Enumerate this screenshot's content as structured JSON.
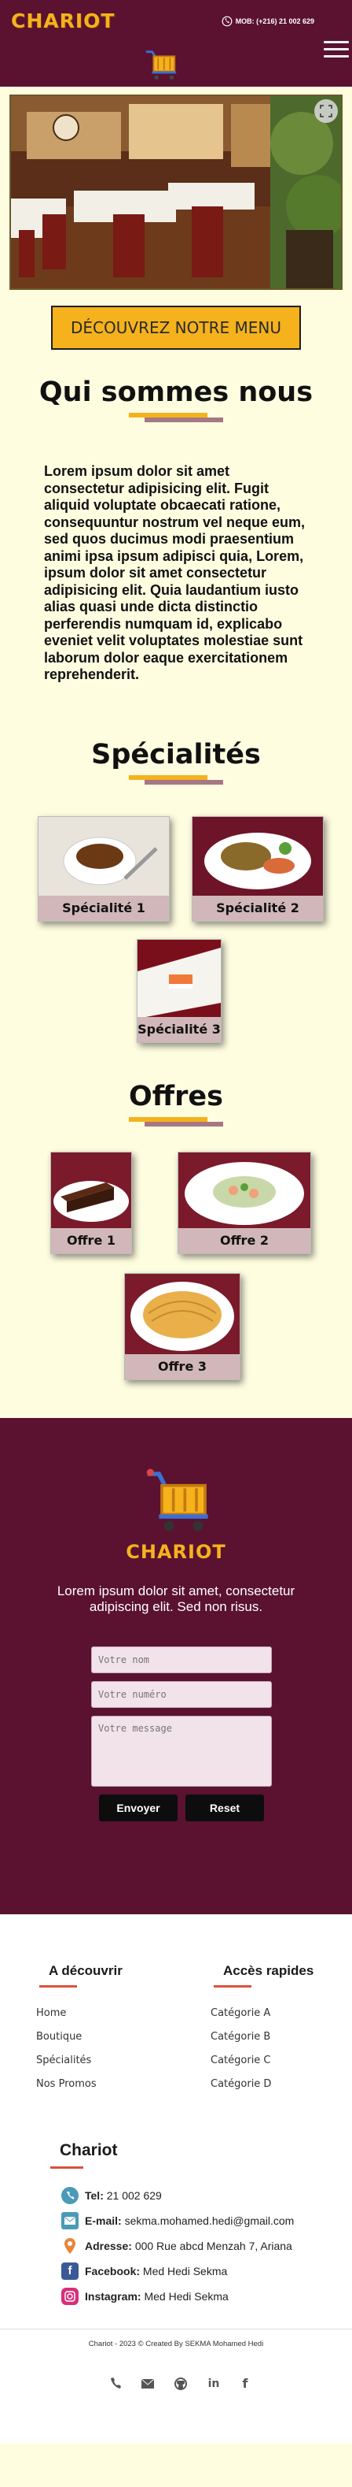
{
  "header": {
    "brand": "CHARIOT",
    "phone": "MOB: (+216) 21 002 629"
  },
  "hero": {
    "cta": "DÉCOUVREZ NOTRE MENU"
  },
  "about": {
    "title": "Qui sommes nous",
    "text": "Lorem ipsum dolor sit amet consectetur adipisicing elit. Fugit aliquid voluptate obcaecati ratione, consequuntur nostrum vel neque eum, sed quos ducimus modi praesentium animi ipsa ipsum adipisci quia, Lorem, ipsum dolor sit amet consectetur adipisicing elit. Quia laudantium iusto alias quasi unde dicta distinctio perferendis numquam id, explicabo eveniet velit voluptates molestiae sunt laborum dolor eaque exercitationem reprehenderit."
  },
  "specialites": {
    "title": "Spécialités",
    "items": [
      "Spécialité 1",
      "Spécialité 2",
      "Spécialité 3"
    ]
  },
  "offres": {
    "title": "Offres",
    "items": [
      "Offre 1",
      "Offre 2",
      "Offre 3"
    ]
  },
  "contact": {
    "brand": "CHARIOT",
    "text": "Lorem ipsum dolor sit amet, consectetur adipiscing elit. Sed non risus.",
    "name_placeholder": "Votre nom",
    "number_placeholder": "Votre numéro",
    "message_placeholder": "Votre message",
    "send": "Envoyer",
    "reset": "Reset"
  },
  "footer": {
    "col1_title": "A découvrir",
    "col1_links": [
      "Home",
      "Boutique",
      "Spécialités",
      "Nos Promos"
    ],
    "col2_title": "Accès rapides",
    "col2_links": [
      "Catégorie A",
      "Catégorie B",
      "Catégorie C",
      "Catégorie D"
    ],
    "contact_title": "Chariot",
    "tel_label": "Tel:",
    "tel_value": "21 002 629",
    "email_label": "E-mail:",
    "email_value": "sekma.mohamed.hedi@gmail.com",
    "address_label": "Adresse:",
    "address_value": "000 Rue abcd Menzah 7, Ariana",
    "facebook_label": "Facebook:",
    "facebook_value": "Med Hedi Sekma",
    "instagram_label": "Instagram:",
    "instagram_value": "Med Hedi Sekma",
    "copyright": "Chariot - 2023 © Created By SEKMA Mohamed Hedi"
  },
  "colors": {
    "brand_maroon": "#5a1230",
    "accent_yellow": "#f5b21c",
    "page_cream": "#fefde0",
    "caption_pink": "#d1b7b9"
  },
  "icons": [
    "phone-icon",
    "cart-icon",
    "menu-icon",
    "fullscreen-icon",
    "envelope-icon",
    "location-icon",
    "facebook-icon",
    "instagram-icon",
    "github-icon",
    "linkedin-icon"
  ]
}
